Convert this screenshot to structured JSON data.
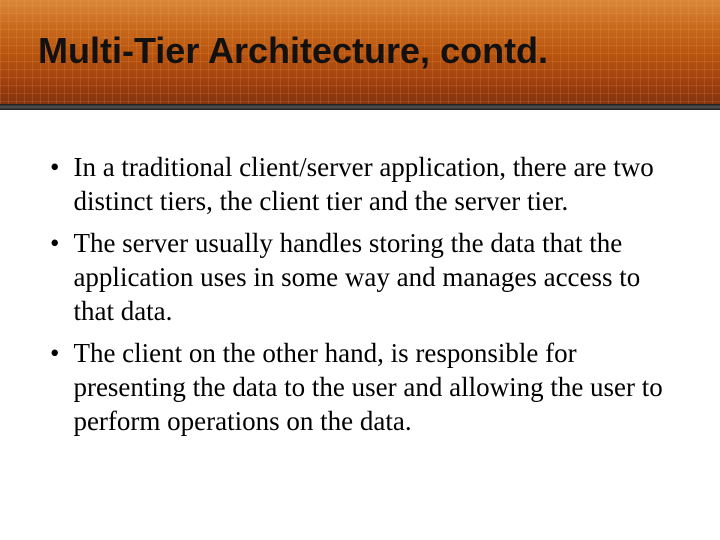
{
  "slide": {
    "title": "Multi-Tier Architecture, contd.",
    "bullets": [
      "In a traditional client/server application, there are two distinct tiers, the client tier and the server tier.",
      "The server usually handles storing the data that the application uses in some way and manages access to that data.",
      "The client on the other hand, is responsible for presenting the data to the user and allowing the user to perform operations on the data."
    ]
  }
}
